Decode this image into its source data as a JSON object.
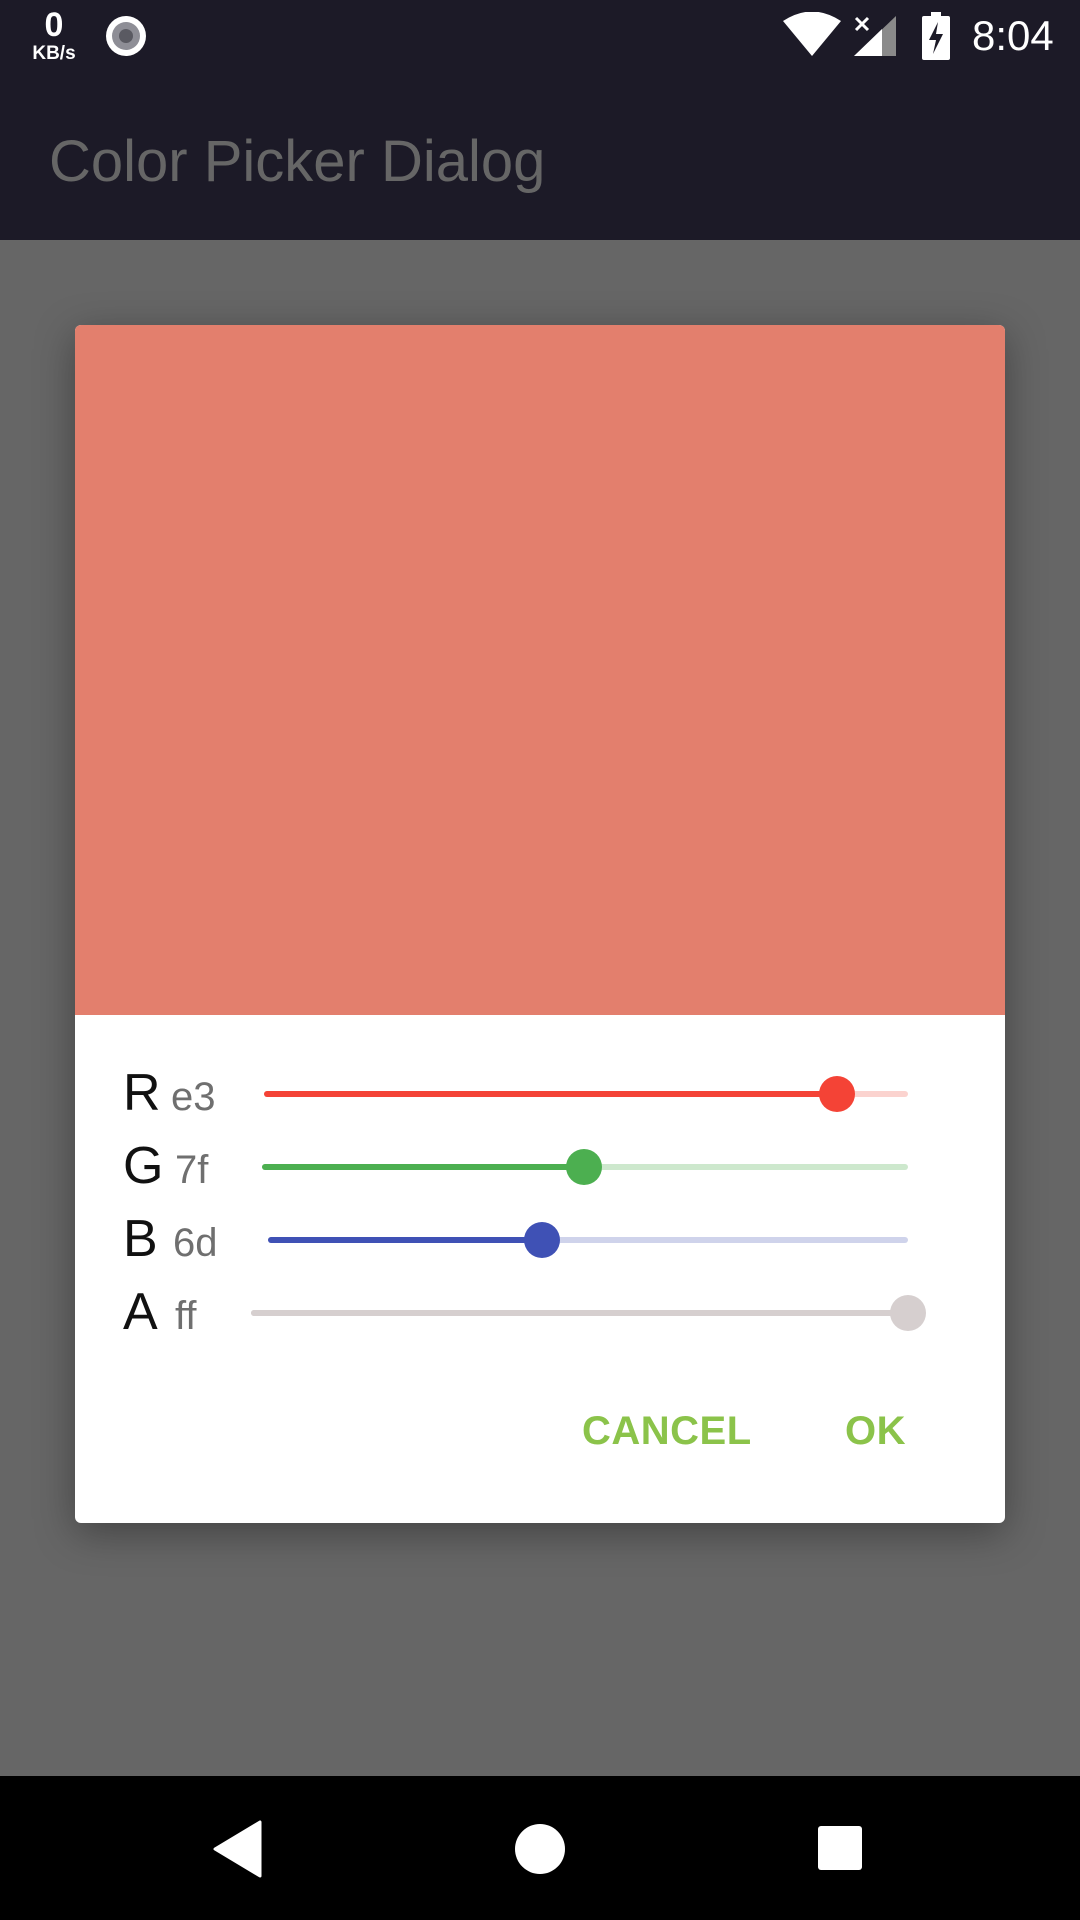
{
  "status_bar": {
    "net_speed_value": "0",
    "net_speed_unit": "KB/s",
    "time": "8:04"
  },
  "app_bar": {
    "title": "Color Picker Dialog"
  },
  "dialog": {
    "preview_color": "#e37f6d",
    "channels": [
      {
        "label": "R",
        "hex": "e3",
        "value": 227,
        "color": "#f44336",
        "track_color": "#fbd3cf"
      },
      {
        "label": "G",
        "hex": "7f",
        "value": 127,
        "color": "#4caf50",
        "track_color": "#cde8cd"
      },
      {
        "label": "B",
        "hex": "6d",
        "value": 109,
        "color": "#3f51b5",
        "track_color": "#cfd3eb"
      },
      {
        "label": "A",
        "hex": "ff",
        "value": 255,
        "color": "#d6cfcf",
        "track_color": "#d6cfcf"
      }
    ],
    "cancel_label": "CANCEL",
    "ok_label": "OK",
    "accent_color": "#8bc34a"
  },
  "nav_bar": {
    "back_icon": "back-triangle-icon",
    "home_icon": "home-circle-icon",
    "recent_icon": "recent-square-icon"
  }
}
